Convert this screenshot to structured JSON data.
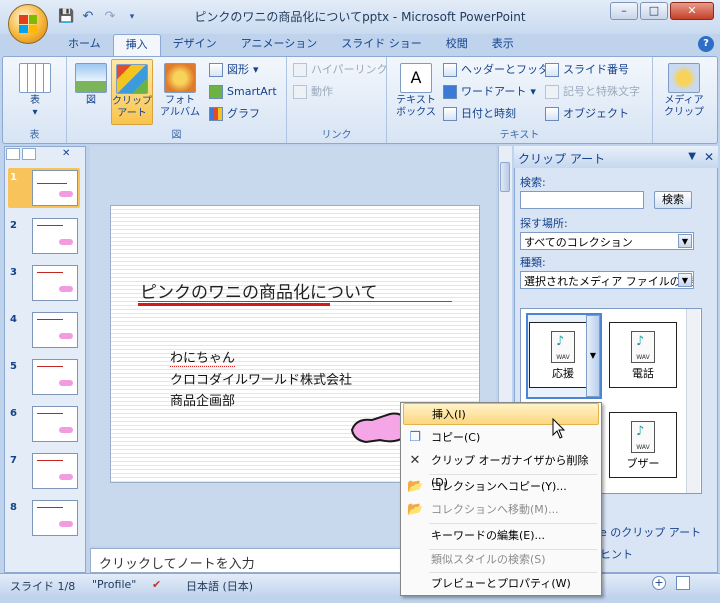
{
  "window": {
    "title": "ピンクのワニの商品化についてpptx - Microsoft PowerPoint"
  },
  "tabs": [
    {
      "label": "ホーム"
    },
    {
      "label": "挿入",
      "active": true
    },
    {
      "label": "デザイン"
    },
    {
      "label": "アニメーション"
    },
    {
      "label": "スライド ショー"
    },
    {
      "label": "校閲"
    },
    {
      "label": "表示"
    }
  ],
  "ribbon": {
    "table": {
      "btn": "表",
      "group": "表"
    },
    "picture": {
      "btn": "図"
    },
    "clipart": {
      "line1": "クリップ",
      "line2": "アート"
    },
    "photoalbum": {
      "line1": "フォト",
      "line2": "アルバム"
    },
    "shapes": "図形",
    "smartart": "SmartArt",
    "graph": "グラフ",
    "figure_group": "図",
    "hyperlink": "ハイパーリンク",
    "action": "動作",
    "link_group": "リンク",
    "textbox": {
      "line1": "テキスト",
      "line2": "ボックス"
    },
    "headerfooter": "ヘッダーとフッター",
    "wordart": "ワードアート",
    "datetime": "日付と時刻",
    "slidenum": "スライド番号",
    "symbol": "記号と特殊文字",
    "object": "オブジェクト",
    "text_group": "テキスト",
    "media": {
      "line1": "メディア",
      "line2": "クリップ"
    }
  },
  "thumbnails": [
    "1",
    "2",
    "3",
    "4",
    "5",
    "6",
    "7",
    "8"
  ],
  "slide": {
    "title": "ピンクのワニの商品化について",
    "line1": "わにちゃん",
    "line2": "クロコダイルワールド株式会社",
    "line3": "商品企画部"
  },
  "notes": "クリックしてノートを入力",
  "taskpane": {
    "title": "クリップ アート",
    "search_label": "検索:",
    "search_value": "",
    "search_btn": "検索",
    "location_label": "探す場所:",
    "location_value": "すべてのコレクション",
    "type_label": "種類:",
    "type_value": "選択されたメディア ファイルの種類",
    "clips": [
      {
        "caption": "応援"
      },
      {
        "caption": "電話"
      },
      {
        "caption": "ブザー"
      }
    ],
    "link1": "e のクリップ アート",
    "link2": "ヒント"
  },
  "context_menu": [
    {
      "label": "挿入(I)",
      "icon": "insert",
      "highlight": true
    },
    {
      "label": "コピー(C)",
      "icon": "copy-icon"
    },
    {
      "label": "クリップ オーガナイザから削除(D)",
      "icon": "delete-x-icon"
    },
    {
      "label": "コレクションへコピー(Y)...",
      "icon": "copy-to-collection-icon"
    },
    {
      "label": "コレクションへ移動(M)...",
      "icon": "move-to-collection-icon",
      "disabled": true
    },
    {
      "label": "キーワードの編集(E)...",
      "icon": ""
    },
    {
      "label": "類似スタイルの検索(S)",
      "icon": "",
      "disabled": true
    },
    {
      "label": "プレビューとプロパティ(W)",
      "icon": ""
    }
  ],
  "status": {
    "slide": "スライド 1/8",
    "theme": "\"Profile\"",
    "language": "日本語 (日本)"
  },
  "colors": {
    "accent": "#15428b",
    "highlight": "#fcd77f",
    "pink": "#f29ce0"
  }
}
